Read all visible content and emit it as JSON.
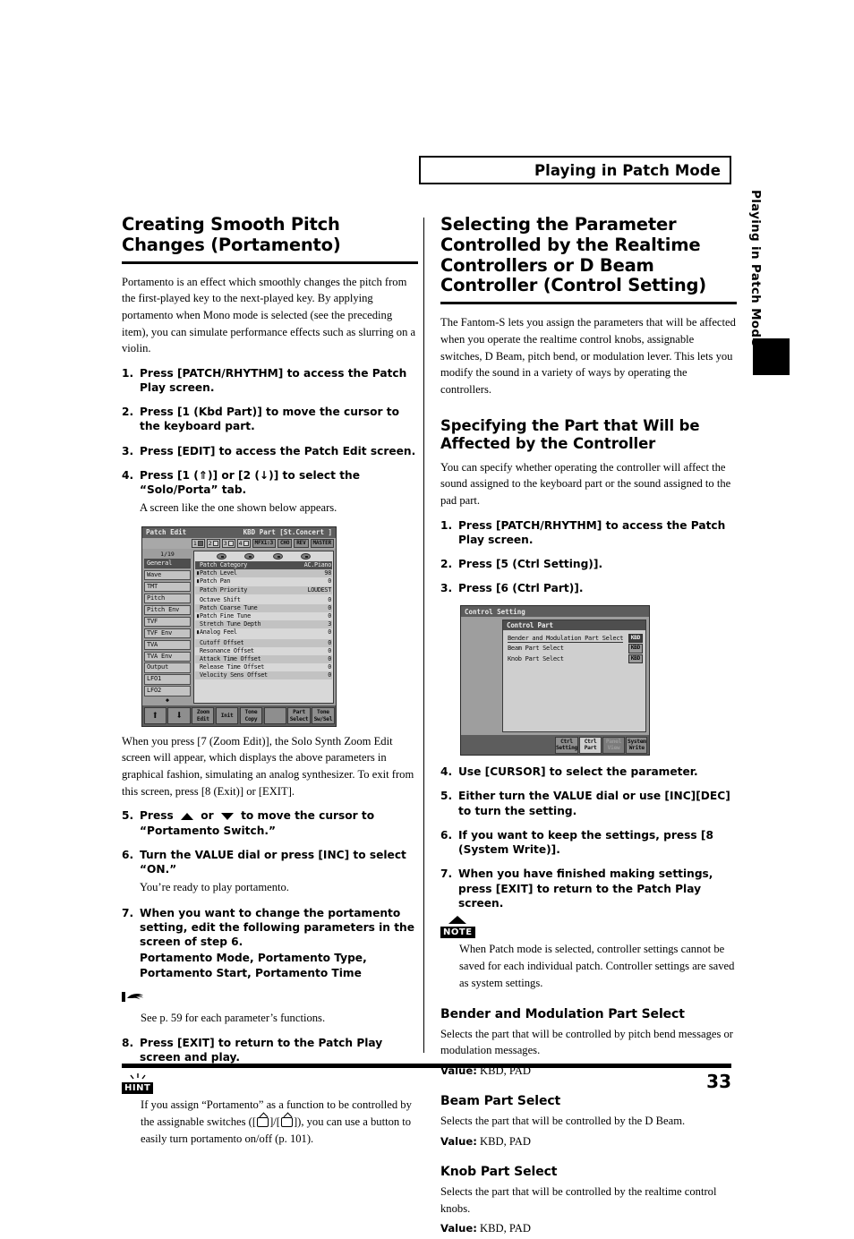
{
  "header": {
    "title": "Playing in Patch Mode"
  },
  "side_tab": {
    "label": "Playing in Patch Mode"
  },
  "footer": {
    "page_number": "33"
  },
  "left_column": {
    "heading": "Creating Smooth Pitch Changes (Portamento)",
    "intro": "Portamento is an effect which smoothly changes the pitch from the first-played key to the next-played key. By applying portamento when Mono mode is selected (see the preceding item), you can simulate performance effects such as slurring on a violin.",
    "steps": [
      {
        "num": "1.",
        "text": "Press [PATCH/RHYTHM] to access the Patch Play screen."
      },
      {
        "num": "2.",
        "text": "Press [1 (Kbd Part)] to move the cursor to the keyboard part."
      },
      {
        "num": "3.",
        "text": "Press [EDIT] to access the Patch Edit screen."
      },
      {
        "num": "4.",
        "text": "Press [1 (⇑)] or [2 (↓)] to select the “Solo/Porta” tab.",
        "sub": "A screen like the one shown below appears."
      }
    ],
    "after_screen": "When you press [7 (Zoom Edit)], the Solo Synth Zoom Edit screen will appear, which displays the above parameters in graphical fashion, simulating an analog synthesizer. To exit from this screen, press [8 (Exit)] or [EXIT].",
    "steps2": [
      {
        "num": "5.",
        "text_a": "Press",
        "text_b": "or",
        "text_c": "to move the cursor to “Portamento Switch.”"
      },
      {
        "num": "6.",
        "text": "Turn the VALUE dial or press [INC] to select “ON.”",
        "sub": "You’re ready to play portamento."
      },
      {
        "num": "7.",
        "text": "When you want to change the portamento setting, edit the following parameters in the screen of step 6.",
        "sub_bold": "Portamento Mode, Portamento Type, Portamento Start, Portamento Time"
      }
    ],
    "reference": {
      "icon": "pointing-hand-icon",
      "text": "See p. 59 for each parameter’s functions."
    },
    "step8": {
      "num": "8.",
      "text": "Press [EXIT] to return to the Patch Play screen and play."
    },
    "hint": {
      "badge": "HINT",
      "text_a": "If you assign “Portamento” as a function to be controlled by the assignable switches ([",
      "text_b": "]/[",
      "text_c": "]), you can use a button to easily turn portamento on/off (p. 101)."
    }
  },
  "patch_edit_lcd": {
    "title": "Patch Edit",
    "title_right": "KBD Part  [St.Concert  ]",
    "part_buttons": [
      {
        "label": "1",
        "state": "on"
      },
      {
        "label": "2",
        "state": "off"
      },
      {
        "label": "3",
        "state": "off"
      },
      {
        "label": "4",
        "state": "off"
      }
    ],
    "fx_buttons": [
      "MFX1:3",
      "CHO",
      "REV",
      "MASTER"
    ],
    "page_indicator": "1/19",
    "tabs": [
      {
        "label": "General",
        "selected": true
      },
      {
        "label": "Wave",
        "selected": false
      },
      {
        "label": "TMT",
        "selected": false
      },
      {
        "label": "Pitch",
        "selected": false
      },
      {
        "label": "Pitch Env",
        "selected": false
      },
      {
        "label": "TVF",
        "selected": false
      },
      {
        "label": "TVF Env",
        "selected": false
      },
      {
        "label": "TVA",
        "selected": false
      },
      {
        "label": "TVA Env",
        "selected": false
      },
      {
        "label": "Output",
        "selected": false
      },
      {
        "label": "LFO1",
        "selected": false
      },
      {
        "label": "LFO2",
        "selected": false
      }
    ],
    "param_groups": [
      {
        "rows": [
          {
            "mark": "",
            "name": "Patch Category",
            "value": "AC.Piano",
            "highlight": true
          },
          {
            "mark": "▮",
            "name": "Patch Level",
            "value": "98",
            "alt": true
          },
          {
            "mark": "▮",
            "name": "Patch Pan",
            "value": "0"
          },
          {
            "mark": "",
            "name": "Patch Priority",
            "value": "LOUDEST",
            "alt": true
          }
        ]
      },
      {
        "rows": [
          {
            "mark": "",
            "name": "Octave Shift",
            "value": "0"
          },
          {
            "mark": "",
            "name": "Patch Coarse Tune",
            "value": "0",
            "alt": true
          },
          {
            "mark": "▮",
            "name": "Patch Fine Tune",
            "value": "0"
          },
          {
            "mark": "",
            "name": "Stretch Tune Depth",
            "value": "3",
            "alt": true
          },
          {
            "mark": "▮",
            "name": "Analog Feel",
            "value": "0"
          }
        ]
      },
      {
        "rows": [
          {
            "mark": "",
            "name": "Cutoff Offset",
            "value": "0",
            "alt": true
          },
          {
            "mark": "",
            "name": "Resonance Offset",
            "value": "0"
          },
          {
            "mark": "",
            "name": "Attack Time Offset",
            "value": "0",
            "alt": true
          },
          {
            "mark": "",
            "name": "Release Time Offset",
            "value": "0"
          },
          {
            "mark": "",
            "name": "Velocity Sens Offset",
            "value": "0",
            "alt": true
          }
        ]
      }
    ],
    "function_buttons": [
      {
        "label": "⬆",
        "type": "arrow"
      },
      {
        "label": "⬇",
        "type": "arrow"
      },
      {
        "label": "Zoom Edit",
        "type": "text"
      },
      {
        "label": "Init",
        "type": "text"
      },
      {
        "label": "Tone Copy",
        "type": "text"
      },
      {
        "label": "",
        "type": "blank"
      },
      {
        "label": "Part Select",
        "type": "text"
      },
      {
        "label": "Tone Sw/Sel",
        "type": "text"
      }
    ]
  },
  "right_column": {
    "heading": "Selecting the Parameter Controlled by the Realtime Controllers or D Beam Controller (Control Setting)",
    "intro": "The Fantom-S lets you assign the parameters that will be affected when you operate the realtime control knobs, assignable switches, D Beam, pitch bend, or modulation lever. This lets you modify the sound in a variety of ways by operating the controllers.",
    "subheading": "Specifying the Part that Will be Affected by the Controller",
    "sub_intro": "You can specify whether operating the controller will affect the sound assigned to the keyboard part or the sound assigned to the pad part.",
    "steps": [
      {
        "num": "1.",
        "text": "Press [PATCH/RHYTHM] to access the Patch Play screen."
      },
      {
        "num": "2.",
        "text": "Press [5 (Ctrl Setting)]."
      },
      {
        "num": "3.",
        "text": "Press [6 (Ctrl Part)]."
      }
    ],
    "steps2": [
      {
        "num": "4.",
        "text": "Use [CURSOR] to select the parameter."
      },
      {
        "num": "5.",
        "text": "Either turn the VALUE dial or use [INC][DEC] to turn the setting."
      },
      {
        "num": "6.",
        "text": "If you want to keep the settings, press [8 (System Write)]."
      },
      {
        "num": "7.",
        "text": "When you have finished making settings, press [EXIT] to return to the Patch Play screen."
      }
    ],
    "note": {
      "badge": "NOTE",
      "text": "When Patch mode is selected, controller settings cannot be saved for each individual patch. Controller settings are saved as system settings."
    },
    "params": [
      {
        "title": "Bender and Modulation Part Select",
        "desc": "Selects the part that will be controlled by pitch bend messages or modulation messages.",
        "value_label": "Value:",
        "value": "KBD, PAD"
      },
      {
        "title": "Beam Part Select",
        "desc": "Selects the part that will be controlled by the D Beam.",
        "value_label": "Value:",
        "value": "KBD, PAD"
      },
      {
        "title": "Knob Part Select",
        "desc": "Selects the part that will be controlled by the realtime control knobs.",
        "value_label": "Value:",
        "value": "KBD, PAD"
      }
    ]
  },
  "control_setting_lcd": {
    "title": "Control Setting",
    "panel_title": "Control Part",
    "rows": [
      {
        "label": "Bender and Modulation Part Select",
        "value": "KBD",
        "selected": true
      },
      {
        "label": "Beam Part Select",
        "value": "KBD",
        "selected": false
      },
      {
        "label": "Knob Part Select",
        "value": "KBD",
        "selected": false
      }
    ],
    "function_buttons": [
      {
        "label": "",
        "type": "blank"
      },
      {
        "label": "",
        "type": "blank"
      },
      {
        "label": "",
        "type": "blank"
      },
      {
        "label": "",
        "type": "blank"
      },
      {
        "label": "Ctrl Setting",
        "type": "text"
      },
      {
        "label": "Ctrl Part",
        "type": "selected"
      },
      {
        "label": "Panel View",
        "type": "dim"
      },
      {
        "label": "System Write",
        "type": "text"
      }
    ]
  }
}
